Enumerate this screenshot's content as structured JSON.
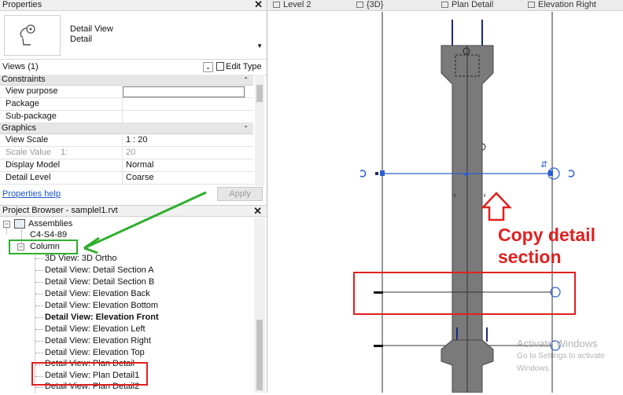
{
  "properties": {
    "title": "Properties",
    "type_name": "Detail View",
    "type_sub": "Detail",
    "views_label": "Views (1)",
    "edit_type": "Edit Type",
    "groups": {
      "constraints": "Constraints",
      "graphics": "Graphics"
    },
    "rows": {
      "view_purpose": {
        "name": "View purpose",
        "value": ""
      },
      "package": {
        "name": "Package",
        "value": ""
      },
      "sub_package": {
        "name": "Sub-package",
        "value": ""
      },
      "view_scale": {
        "name": "View Scale",
        "value": "1 : 20"
      },
      "scale_value": {
        "name": "Scale Value    1:",
        "value": "20"
      },
      "display_model": {
        "name": "Display Model",
        "value": "Normal"
      },
      "detail_level": {
        "name": "Detail Level",
        "value": "Coarse"
      }
    },
    "help_link": "Properties help",
    "apply": "Apply"
  },
  "browser": {
    "title": "Project Browser - samplel1.rvt",
    "items": {
      "assemblies": "Assemblies",
      "c4": "C4-S4-89",
      "column": "Column",
      "v0": "3D View: 3D Ortho",
      "v1": "Detail View: Detail Section A",
      "v2": "Detail View: Detail Section B",
      "v3": "Detail View: Elevation Back",
      "v4": "Detail View: Elevation Bottom",
      "v5": "Detail View: Elevation Front",
      "v6": "Detail View: Elevation Left",
      "v7": "Detail View: Elevation Right",
      "v8": "Detail View: Elevation Top",
      "v9": "Detail View: Plan Detail",
      "v10": "Detail View: Plan Detail1",
      "v11": "Detail View: Plan Detail2"
    }
  },
  "tabs": {
    "t1": "Level 2",
    "t2": "{3D}",
    "t3": "Plan Detail",
    "t4": "Elevation Right"
  },
  "annotation": {
    "line1": "Copy detail",
    "line2": "section"
  },
  "watermark": {
    "line1": "Activate Windows",
    "line2": "Go to Settings to activate Windows."
  },
  "colors": {
    "annotation_red": "#e02020",
    "annotation_green": "#2fae2f",
    "section_blue": "#2a5fd0"
  }
}
